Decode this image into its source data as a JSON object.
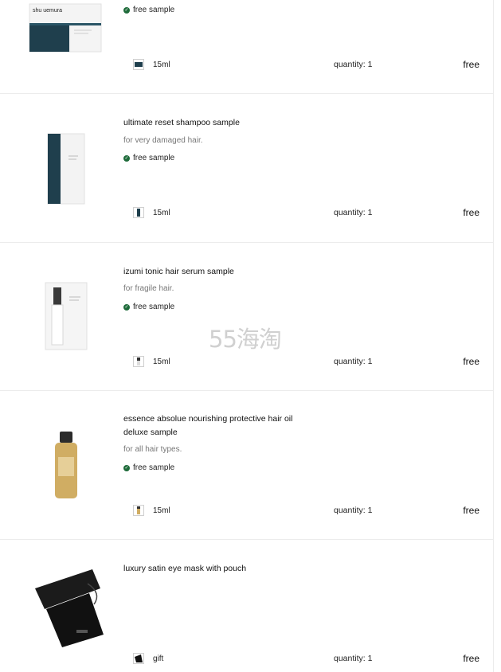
{
  "items": [
    {
      "title": "",
      "description": "",
      "sample_label": "free sample",
      "size": "15ml",
      "quantity": "quantity: 1",
      "price": "free",
      "thumb_icon": "shampoo-sachet-icon",
      "brand": "shu uemura"
    },
    {
      "title": "ultimate reset shampoo sample",
      "description": "for very damaged hair.",
      "sample_label": "free sample",
      "size": "15ml",
      "quantity": "quantity: 1",
      "price": "free",
      "thumb_icon": "shampoo-sachet-icon"
    },
    {
      "title": "izumi tonic hair serum sample",
      "description": "for fragile hair.",
      "sample_label": "free sample",
      "size": "15ml",
      "quantity": "quantity: 1",
      "price": "free",
      "thumb_icon": "serum-sachet-icon"
    },
    {
      "title": "essence absolue nourishing protective hair oil deluxe sample",
      "description": "for all hair types.",
      "sample_label": "free sample",
      "size": "15ml",
      "quantity": "quantity: 1",
      "price": "free",
      "thumb_icon": "oil-bottle-icon"
    },
    {
      "title": "luxury satin eye mask with pouch",
      "description": "",
      "sample_label": "",
      "size": "gift",
      "quantity": "quantity: 1",
      "price": "free",
      "thumb_icon": "eye-mask-icon"
    }
  ],
  "watermark": "55海淘",
  "colors": {
    "check_green": "#1e6b3a",
    "divider": "#ececec",
    "muted_text": "#777777",
    "navy": "#1f3f4d",
    "oil": "#d0ad63"
  }
}
